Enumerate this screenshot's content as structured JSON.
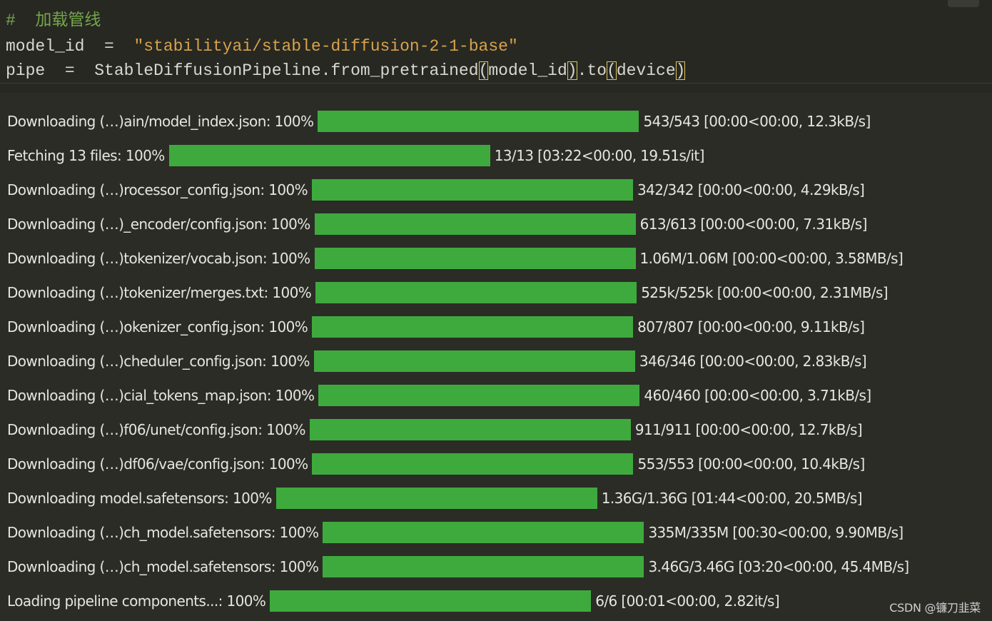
{
  "code": {
    "comment": "#  加载管线",
    "model_id_var": "model_id",
    "assign_op": "=",
    "model_id_value": "\"stabilityai/stable-diffusion-2-1-base\"",
    "pipe_var": "pipe",
    "pipe_call": "StableDiffusionPipeline.from_pretrained",
    "pipe_arg": "model_id",
    "to_method": ".to",
    "to_arg": "device"
  },
  "progress_rows": [
    {
      "label": "Downloading (…)ain/model_index.json: 100%",
      "fraction": 1.0,
      "stats": "543/543 [00:00<00:00, 12.3kB/s]"
    },
    {
      "label": "Fetching 13 files: 100%",
      "fraction": 1.0,
      "stats": "13/13 [03:22<00:00, 19.51s/it]"
    },
    {
      "label": "Downloading (…)rocessor_config.json: 100%",
      "fraction": 1.0,
      "stats": "342/342 [00:00<00:00, 4.29kB/s]"
    },
    {
      "label": "Downloading (…)_encoder/config.json: 100%",
      "fraction": 1.0,
      "stats": "613/613 [00:00<00:00, 7.31kB/s]"
    },
    {
      "label": "Downloading (…)tokenizer/vocab.json: 100%",
      "fraction": 1.0,
      "stats": "1.06M/1.06M [00:00<00:00, 3.58MB/s]"
    },
    {
      "label": "Downloading (…)tokenizer/merges.txt: 100%",
      "fraction": 1.0,
      "stats": "525k/525k [00:00<00:00, 2.31MB/s]"
    },
    {
      "label": "Downloading (…)okenizer_config.json: 100%",
      "fraction": 1.0,
      "stats": "807/807 [00:00<00:00, 9.11kB/s]"
    },
    {
      "label": "Downloading (…)cheduler_config.json: 100%",
      "fraction": 1.0,
      "stats": "346/346 [00:00<00:00, 2.83kB/s]"
    },
    {
      "label": "Downloading (…)cial_tokens_map.json: 100%",
      "fraction": 1.0,
      "stats": "460/460 [00:00<00:00, 3.71kB/s]"
    },
    {
      "label": "Downloading (…)f06/unet/config.json: 100%",
      "fraction": 1.0,
      "stats": "911/911 [00:00<00:00, 12.7kB/s]"
    },
    {
      "label": "Downloading (…)df06/vae/config.json: 100%",
      "fraction": 1.0,
      "stats": "553/553 [00:00<00:00, 10.4kB/s]"
    },
    {
      "label": "Downloading model.safetensors: 100%",
      "fraction": 1.0,
      "stats": "1.36G/1.36G [01:44<00:00, 20.5MB/s]"
    },
    {
      "label": "Downloading (…)ch_model.safetensors: 100%",
      "fraction": 1.0,
      "stats": "335M/335M [00:30<00:00, 9.90MB/s]"
    },
    {
      "label": "Downloading (…)ch_model.safetensors: 100%",
      "fraction": 1.0,
      "stats": "3.46G/3.46G [03:20<00:00, 45.4MB/s]"
    },
    {
      "label": "Loading pipeline components...: 100%",
      "fraction": 1.0,
      "stats": "6/6 [00:01<00:00, 2.82it/s]"
    }
  ],
  "watermark": "CSDN @镰刀韭菜",
  "colors": {
    "bar_fill": "#3eaa3e",
    "background": "#2b2c26",
    "comment": "#75a64b",
    "string": "#d8a24a"
  }
}
